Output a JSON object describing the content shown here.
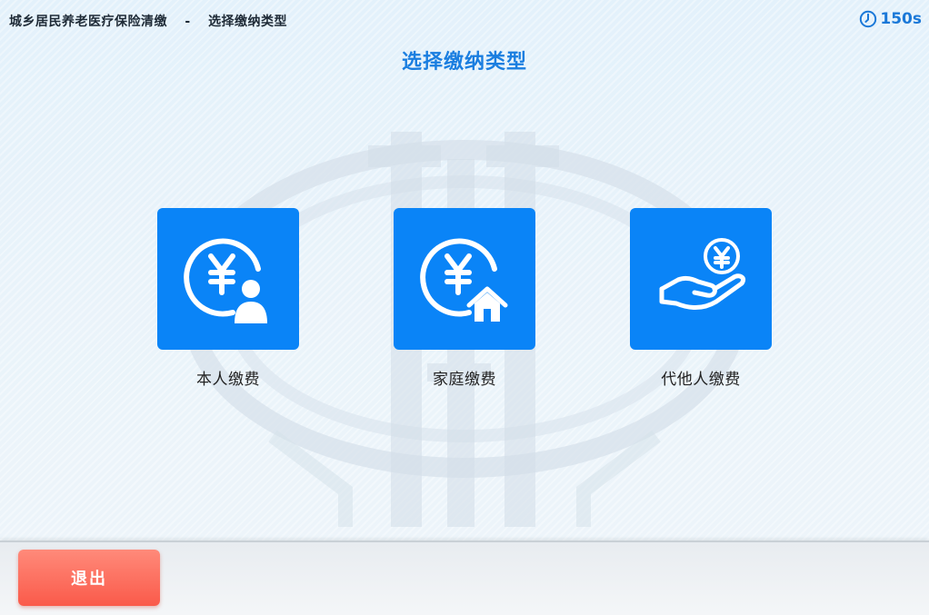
{
  "header": {
    "app_title": "城乡居民养老医疗保险清缴",
    "separator": "-",
    "current_step": "选择缴纳类型",
    "timer": "150s"
  },
  "main": {
    "title": "选择缴纳类型",
    "options": [
      {
        "label": "本人缴费",
        "icon": "yuan-person-icon"
      },
      {
        "label": "家庭缴费",
        "icon": "yuan-house-icon"
      },
      {
        "label": "代他人缴费",
        "icon": "hand-coin-icon"
      }
    ]
  },
  "footer": {
    "exit_label": "退出"
  },
  "colors": {
    "tile_blue": "#0a84f7",
    "title_blue": "#1a7ee0",
    "exit_red": "#fa5a4a"
  }
}
